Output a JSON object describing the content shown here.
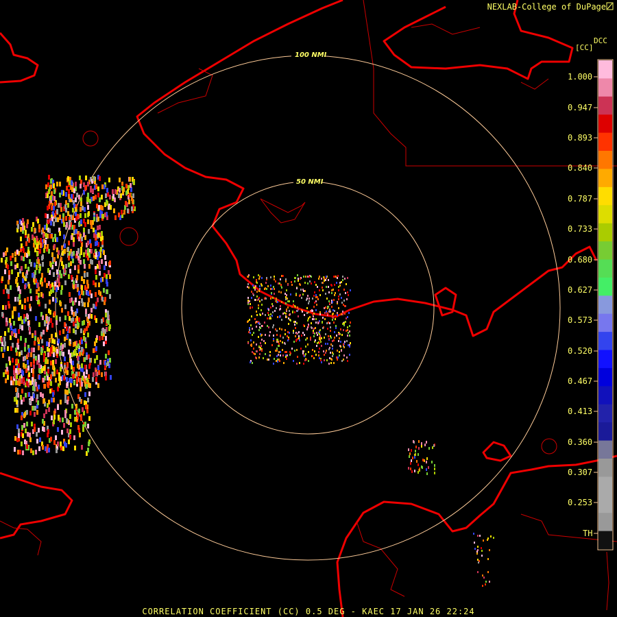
{
  "credit": "NEXLAB-College of DuPage",
  "footer": "CORRELATION COEFFICIENT (CC) 0.5 DEG - KAEC 17 JAN 26 22:24",
  "legend": {
    "product_code": "DCC",
    "unit": "[CC]",
    "ticks": [
      "1.000",
      "0.947",
      "0.893",
      "0.840",
      "0.787",
      "0.733",
      "0.680",
      "0.627",
      "0.573",
      "0.520",
      "0.467",
      "0.413",
      "0.360",
      "0.307",
      "0.253",
      "TH"
    ],
    "colors": [
      "#ffbbdd",
      "#ee88aa",
      "#cc3355",
      "#dd0000",
      "#ff3300",
      "#ff7700",
      "#ffaa00",
      "#ffdd00",
      "#dddd00",
      "#aacc00",
      "#77cc33",
      "#55dd55",
      "#44ee66",
      "#8899dd",
      "#7777ee",
      "#3344ee",
      "#1111ff",
      "#0000dd",
      "#1111bb",
      "#2222aa",
      "#1a1a99",
      "#777799",
      "#999999",
      "#aaaaaa",
      "#aaaaaa",
      "#999999",
      "#111111"
    ]
  },
  "range_rings": [
    {
      "label": "50 NMI",
      "nmi": 50
    },
    {
      "label": "100 NMI",
      "nmi": 100
    }
  ],
  "colors": {
    "coastline": "#ee0000",
    "border": "#cc0000",
    "ring": "#ffcc99",
    "text": "#ffff66"
  }
}
